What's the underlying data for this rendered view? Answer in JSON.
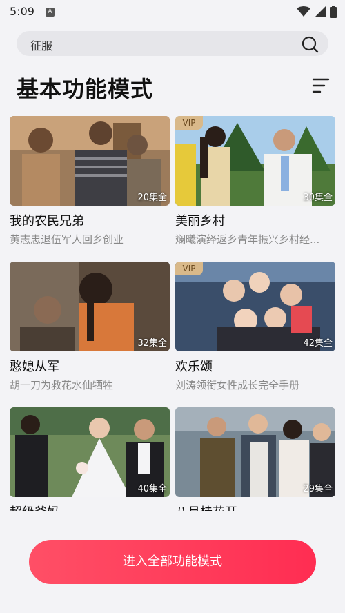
{
  "status": {
    "time": "5:09",
    "a_icon": "A"
  },
  "search": {
    "query": "征服"
  },
  "title": "基本功能模式",
  "cards": [
    {
      "title": "我的农民兄弟",
      "sub": "黄志忠退伍军人回乡创业",
      "episodes": "20集全",
      "vip": false
    },
    {
      "title": "美丽乡村",
      "sub": "斓曦演绎返乡青年振兴乡村经...",
      "episodes": "30集全",
      "vip": true,
      "vip_label": "VIP"
    },
    {
      "title": "憨媳从军",
      "sub": "胡一刀为救花水仙牺牲",
      "episodes": "32集全",
      "vip": false
    },
    {
      "title": "欢乐颂",
      "sub": "刘涛领衔女性成长完全手册",
      "episodes": "42集全",
      "vip": true,
      "vip_label": "VIP"
    },
    {
      "title": "超级爸妈",
      "sub": "",
      "episodes": "40集全",
      "vip": false
    },
    {
      "title": "八月桂花开",
      "sub": "",
      "episodes": "29集全",
      "vip": false
    }
  ],
  "bottom_button": "进入全部功能模式",
  "colors": {
    "accent": "#ff3355",
    "background": "#f3f3f6",
    "vip": "#d9b98a"
  }
}
